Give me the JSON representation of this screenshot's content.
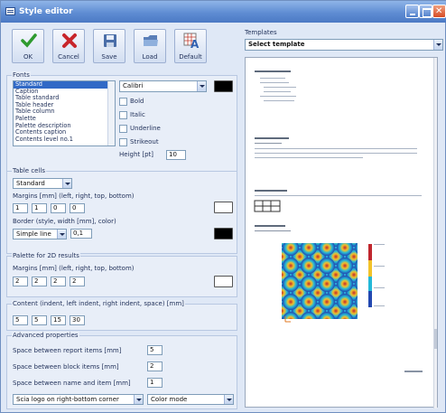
{
  "window": {
    "title": "Style editor"
  },
  "toolbar": {
    "ok_label": "OK",
    "cancel_label": "Cancel",
    "save_label": "Save",
    "load_label": "Load",
    "default_label": "Default"
  },
  "fonts": {
    "section_label": "Fonts",
    "items": [
      "Standard",
      "Caption",
      "Table standard",
      "Table header",
      "Table column",
      "Palette",
      "Palette description",
      "Contents caption",
      "Contents level no.1"
    ],
    "selected_item": "Standard",
    "font_name": "Calibri",
    "bold_label": "Bold",
    "italic_label": "Italic",
    "underline_label": "Underline",
    "strikeout_label": "Strikeout",
    "height_label": "Height [pt]",
    "height_value": "10",
    "color": "#000000"
  },
  "table_cells": {
    "section_label": "Table cells",
    "style": "Standard",
    "margins_label": "Margins [mm] (left, right, top, bottom)",
    "margins": [
      "1",
      "1",
      "0",
      "0"
    ],
    "border_label": "Border (style, width [mm], color)",
    "border_style": "Simple line",
    "border_width": "0,1",
    "cell_color": "#ffffff",
    "border_color": "#000000"
  },
  "palette": {
    "section_label": "Palette for 2D results",
    "margins_label": "Margins [mm] (left, right, top, bottom)",
    "margins": [
      "2",
      "2",
      "2",
      "2"
    ],
    "color": "#ffffff"
  },
  "content": {
    "section_label": "Content (indent, left indent, right indent, space) [mm]",
    "values": [
      "5",
      "5",
      "15",
      "30"
    ]
  },
  "advanced": {
    "section_label": "Advanced properties",
    "report_items_label": "Space between report items [mm]",
    "report_items_value": "5",
    "block_items_label": "Space between block items [mm]",
    "block_items_value": "2",
    "name_item_label": "Space between name and item [mm]",
    "name_item_value": "1",
    "logo_option": "Scia logo on right-bottom corner",
    "color_mode": "Color mode"
  },
  "templates": {
    "section_label": "Templates",
    "placeholder": "Select template"
  },
  "colors": {
    "titlebar": "#5f8dd3",
    "selection": "#3169c6",
    "window_bg": "#dfe8f6"
  }
}
